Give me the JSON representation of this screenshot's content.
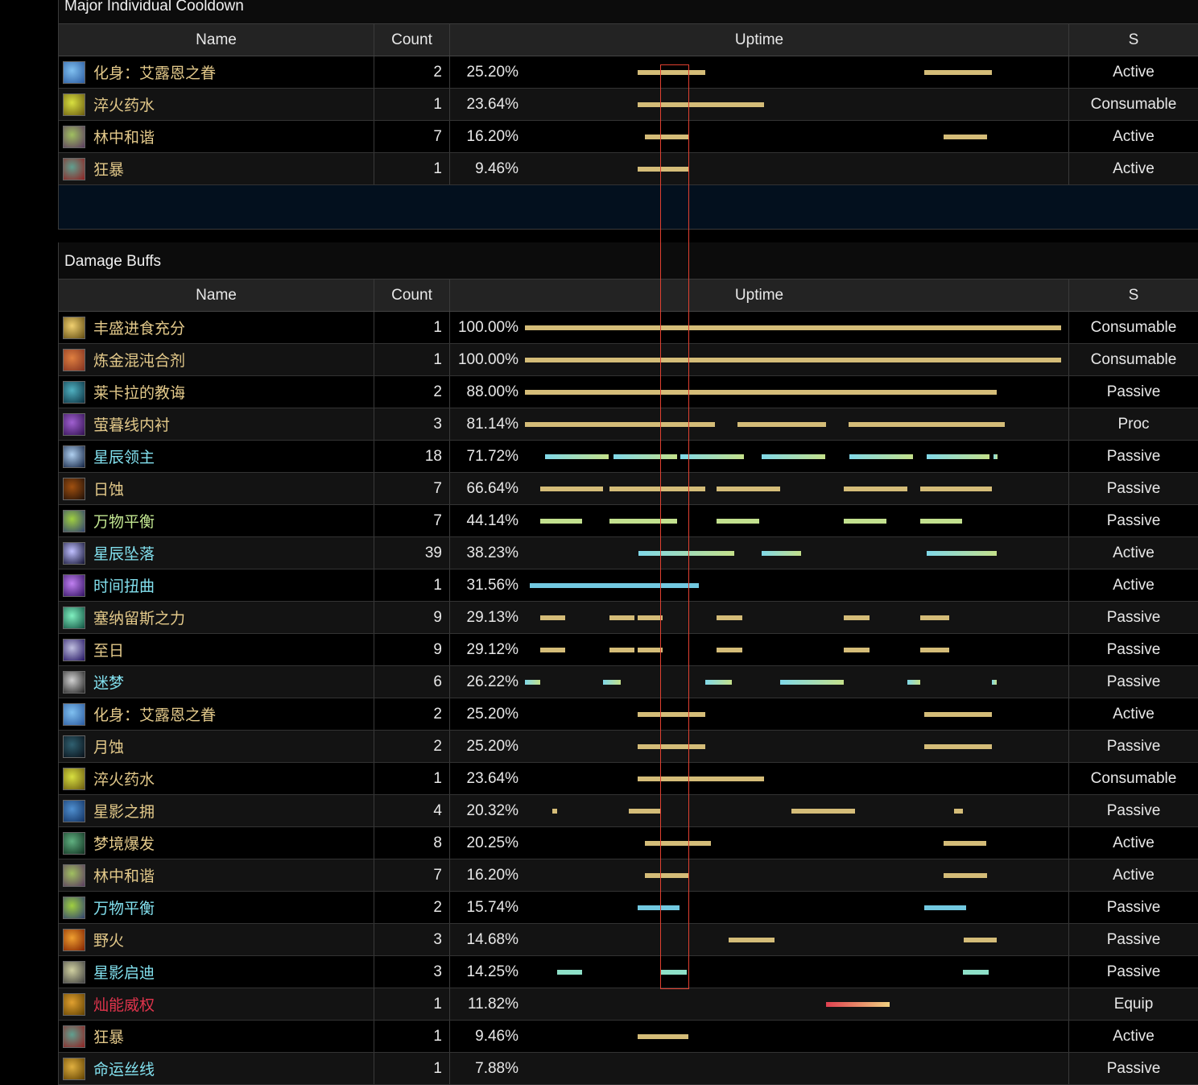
{
  "colors": {
    "gold": "#e3c98a",
    "cyan": "#82e0ee",
    "green": "#c4e892",
    "red": "#e0344c",
    "bar_gold": "#d4bc78",
    "bar_green": "#c2e08e",
    "bar_cyan_start": "#80d8e8",
    "bar_cyan_end": "#c4e08a",
    "bar_blue": "#72c8e0",
    "bar_teal": "#8ee0c8"
  },
  "headers": {
    "name": "Name",
    "count": "Count",
    "uptime": "Uptime",
    "status": "S"
  },
  "sections": [
    {
      "title": "Major Individual Cooldown",
      "rows": [
        {
          "name": "化身：艾露恩之眷",
          "color": "gold",
          "icon": "incarnation-icon",
          "ic": [
            "#2a5aa0",
            "#80c0f0"
          ],
          "count": "2",
          "uptime": "25.20%",
          "status": "Active",
          "bar": "bar_gold",
          "segs": [
            [
              21.0,
              33.6
            ],
            [
              74.5,
              87.1
            ]
          ]
        },
        {
          "name": "淬火药水",
          "color": "gold",
          "icon": "tempered-potion-icon",
          "ic": [
            "#6a5a10",
            "#d8e040"
          ],
          "count": "1",
          "uptime": "23.64%",
          "status": "Consumable",
          "bar": "bar_gold",
          "segs": [
            [
              21.0,
              44.6
            ]
          ]
        },
        {
          "name": "林中和谐",
          "color": "gold",
          "icon": "harmony-of-the-grove-icon",
          "ic": [
            "#5a3a60",
            "#a0c060"
          ],
          "count": "7",
          "uptime": "16.20%",
          "status": "Active",
          "bar": "bar_gold",
          "segs": [
            [
              22.4,
              30.5
            ],
            [
              78.1,
              86.2
            ]
          ]
        },
        {
          "name": "狂暴",
          "color": "gold",
          "icon": "berserk-icon",
          "ic": [
            "#902020",
            "#60a090"
          ],
          "count": "1",
          "uptime": "9.46%",
          "status": "Active",
          "bar": "bar_gold",
          "segs": [
            [
              21.0,
              30.5
            ]
          ]
        }
      ]
    },
    {
      "title": "Damage Buffs",
      "rows": [
        {
          "name": "丰盛进食充分",
          "color": "gold",
          "icon": "well-fed-icon",
          "ic": [
            "#604a10",
            "#f0d070"
          ],
          "count": "1",
          "uptime": "100.00%",
          "status": "Consumable",
          "bar": "bar_gold",
          "segs": [
            [
              0,
              100
            ]
          ]
        },
        {
          "name": "炼金混沌合剂",
          "color": "gold",
          "icon": "flask-icon",
          "ic": [
            "#803020",
            "#e08040"
          ],
          "count": "1",
          "uptime": "100.00%",
          "status": "Consumable",
          "bar": "bar_gold",
          "segs": [
            [
              0,
              100
            ]
          ]
        },
        {
          "name": "莱卡拉的教诲",
          "color": "gold",
          "icon": "leaf-icon",
          "ic": [
            "#0a3040",
            "#50b0c0"
          ],
          "count": "2",
          "uptime": "88.00%",
          "status": "Passive",
          "bar": "bar_gold",
          "segs": [
            [
              0,
              88.0
            ]
          ]
        },
        {
          "name": "萤暮线内衬",
          "color": "gold",
          "icon": "lining-icon",
          "ic": [
            "#301050",
            "#a060d0"
          ],
          "count": "3",
          "uptime": "81.14%",
          "status": "Proc",
          "bar": "bar_gold",
          "segs": [
            [
              0,
              35.4
            ],
            [
              39.6,
              56.2
            ],
            [
              60.4,
              89.5
            ]
          ]
        },
        {
          "name": "星辰领主",
          "color": "cyan",
          "icon": "astral-lord-icon",
          "ic": [
            "#102040",
            "#b0d0f0"
          ],
          "count": "18",
          "uptime": "71.72%",
          "status": "Passive",
          "bar": "bar_cyan",
          "segs": [
            [
              3.8,
              15.6
            ],
            [
              16.5,
              28.4
            ],
            [
              29.0,
              40.8
            ],
            [
              44.1,
              56.0
            ],
            [
              60.5,
              72.4
            ],
            [
              74.9,
              86.6
            ],
            [
              87.4,
              88.0
            ]
          ]
        },
        {
          "name": "日蚀",
          "color": "gold",
          "icon": "solar-eclipse-icon",
          "ic": [
            "#201008",
            "#a05010"
          ],
          "count": "7",
          "uptime": "66.64%",
          "status": "Passive",
          "bar": "bar_gold",
          "segs": [
            [
              2.9,
              14.6
            ],
            [
              15.8,
              33.6
            ],
            [
              35.7,
              47.6
            ],
            [
              59.5,
              71.3
            ],
            [
              73.7,
              87.1
            ]
          ]
        },
        {
          "name": "万物平衡",
          "color": "green",
          "icon": "balance-icon",
          "ic": [
            "#304070",
            "#a0d040"
          ],
          "count": "7",
          "uptime": "44.14%",
          "status": "Passive",
          "bar": "bar_green",
          "segs": [
            [
              2.9,
              10.7
            ],
            [
              15.8,
              28.4
            ],
            [
              35.7,
              43.7
            ],
            [
              59.5,
              67.4
            ],
            [
              73.7,
              81.5
            ]
          ]
        },
        {
          "name": "星辰坠落",
          "color": "cyan",
          "icon": "starfall-icon",
          "ic": [
            "#101030",
            "#c0c0ff"
          ],
          "count": "39",
          "uptime": "38.23%",
          "status": "Active",
          "bar": "bar_cyan",
          "segs": [
            [
              21.2,
              39.0
            ],
            [
              44.1,
              51.5
            ],
            [
              74.9,
              88.0
            ]
          ]
        },
        {
          "name": "时间扭曲",
          "color": "cyan",
          "icon": "time-warp-icon",
          "ic": [
            "#301060",
            "#c080f0"
          ],
          "count": "1",
          "uptime": "31.56%",
          "status": "Active",
          "bar": "bar_blue",
          "segs": [
            [
              0.9,
              32.4
            ]
          ]
        },
        {
          "name": "塞纳留斯之力",
          "color": "gold",
          "icon": "cenarius-icon",
          "ic": [
            "#105040",
            "#80f0c0"
          ],
          "count": "9",
          "uptime": "29.13%",
          "status": "Passive",
          "bar": "bar_gold",
          "segs": [
            [
              2.9,
              7.5
            ],
            [
              15.8,
              20.4
            ],
            [
              21.0,
              25.7
            ],
            [
              35.8,
              40.5
            ],
            [
              59.5,
              64.3
            ],
            [
              73.7,
              79.1
            ]
          ]
        },
        {
          "name": "至日",
          "color": "gold",
          "icon": "solstice-icon",
          "ic": [
            "#201060",
            "#c0c0e0"
          ],
          "count": "9",
          "uptime": "29.12%",
          "status": "Passive",
          "bar": "bar_gold",
          "segs": [
            [
              2.9,
              7.5
            ],
            [
              15.8,
              20.4
            ],
            [
              21.0,
              25.7
            ],
            [
              35.8,
              40.5
            ],
            [
              59.5,
              64.3
            ],
            [
              73.7,
              79.1
            ]
          ]
        },
        {
          "name": "迷梦",
          "color": "cyan",
          "icon": "dreamstate-icon",
          "ic": [
            "#202020",
            "#d0d0d0"
          ],
          "count": "6",
          "uptime": "26.22%",
          "status": "Passive",
          "bar": "bar_cyan",
          "segs": [
            [
              0,
              2.9
            ],
            [
              14.6,
              17.9
            ],
            [
              33.6,
              38.6
            ],
            [
              47.6,
              59.5
            ],
            [
              71.3,
              73.7
            ],
            [
              87.1,
              88.0
            ]
          ]
        },
        {
          "name": "化身：艾露恩之眷",
          "color": "gold",
          "icon": "incarnation-icon",
          "ic": [
            "#2a5aa0",
            "#80c0f0"
          ],
          "count": "2",
          "uptime": "25.20%",
          "status": "Active",
          "bar": "bar_gold",
          "segs": [
            [
              21.0,
              33.6
            ],
            [
              74.5,
              87.1
            ]
          ]
        },
        {
          "name": "月蚀",
          "color": "gold",
          "icon": "lunar-eclipse-icon",
          "ic": [
            "#081018",
            "#306070"
          ],
          "count": "2",
          "uptime": "25.20%",
          "status": "Passive",
          "bar": "bar_gold",
          "segs": [
            [
              21.0,
              33.6
            ],
            [
              74.5,
              87.1
            ]
          ]
        },
        {
          "name": "淬火药水",
          "color": "gold",
          "icon": "tempered-potion-icon",
          "ic": [
            "#6a5a10",
            "#d8e040"
          ],
          "count": "1",
          "uptime": "23.64%",
          "status": "Consumable",
          "bar": "bar_gold",
          "segs": [
            [
              21.0,
              44.6
            ]
          ]
        },
        {
          "name": "星影之拥",
          "color": "gold",
          "icon": "astral-embrace-icon",
          "ic": [
            "#103060",
            "#5090d0"
          ],
          "count": "4",
          "uptime": "20.32%",
          "status": "Passive",
          "bar": "bar_gold",
          "segs": [
            [
              5.1,
              6.0
            ],
            [
              19.4,
              25.2
            ],
            [
              49.7,
              61.6
            ],
            [
              80.0,
              81.7
            ]
          ]
        },
        {
          "name": "梦境爆发",
          "color": "gold",
          "icon": "dream-burst-icon",
          "ic": [
            "#103020",
            "#60b080"
          ],
          "count": "8",
          "uptime": "20.25%",
          "status": "Active",
          "bar": "bar_gold",
          "segs": [
            [
              22.4,
              34.7
            ],
            [
              78.1,
              86.0
            ]
          ]
        },
        {
          "name": "林中和谐",
          "color": "gold",
          "icon": "harmony-of-the-grove-icon",
          "ic": [
            "#5a3a60",
            "#a0c060"
          ],
          "count": "7",
          "uptime": "16.20%",
          "status": "Active",
          "bar": "bar_gold",
          "segs": [
            [
              22.4,
              30.5
            ],
            [
              78.1,
              86.2
            ]
          ]
        },
        {
          "name": "万物平衡",
          "color": "cyan",
          "icon": "balance-icon",
          "ic": [
            "#304070",
            "#a0d040"
          ],
          "count": "2",
          "uptime": "15.74%",
          "status": "Passive",
          "bar": "bar_blue",
          "segs": [
            [
              21.0,
              28.8
            ],
            [
              74.5,
              82.3
            ]
          ]
        },
        {
          "name": "野火",
          "color": "gold",
          "icon": "wildfire-icon",
          "ic": [
            "#802000",
            "#f0a030"
          ],
          "count": "3",
          "uptime": "14.68%",
          "status": "Passive",
          "bar": "bar_gold",
          "segs": [
            [
              38.0,
              46.5
            ],
            [
              81.8,
              88.0
            ]
          ]
        },
        {
          "name": "星影启迪",
          "color": "cyan",
          "icon": "astral-insight-icon",
          "ic": [
            "#404040",
            "#d0d0a0"
          ],
          "count": "3",
          "uptime": "14.25%",
          "status": "Passive",
          "bar": "bar_teal",
          "segs": [
            [
              6.0,
              10.7
            ],
            [
              25.2,
              30.2
            ],
            [
              81.7,
              86.5
            ]
          ]
        },
        {
          "name": "灿能威权",
          "color": "red",
          "icon": "authority-icon",
          "ic": [
            "#604000",
            "#e0a030"
          ],
          "count": "1",
          "uptime": "11.82%",
          "status": "Equip",
          "bar": "bar_red",
          "segs": [
            [
              56.2,
              68.0
            ]
          ]
        },
        {
          "name": "狂暴",
          "color": "gold",
          "icon": "berserk-icon",
          "ic": [
            "#902020",
            "#60a090"
          ],
          "count": "1",
          "uptime": "9.46%",
          "status": "Active",
          "bar": "bar_gold",
          "segs": [
            [
              21.0,
              30.5
            ]
          ]
        },
        {
          "name": "命运丝线",
          "color": "cyan",
          "icon": "thread-icon",
          "ic": [
            "#604000",
            "#e0b040"
          ],
          "count": "1",
          "uptime": "7.88%",
          "status": "Passive",
          "bar": "bar_gold",
          "segs": []
        }
      ]
    }
  ]
}
